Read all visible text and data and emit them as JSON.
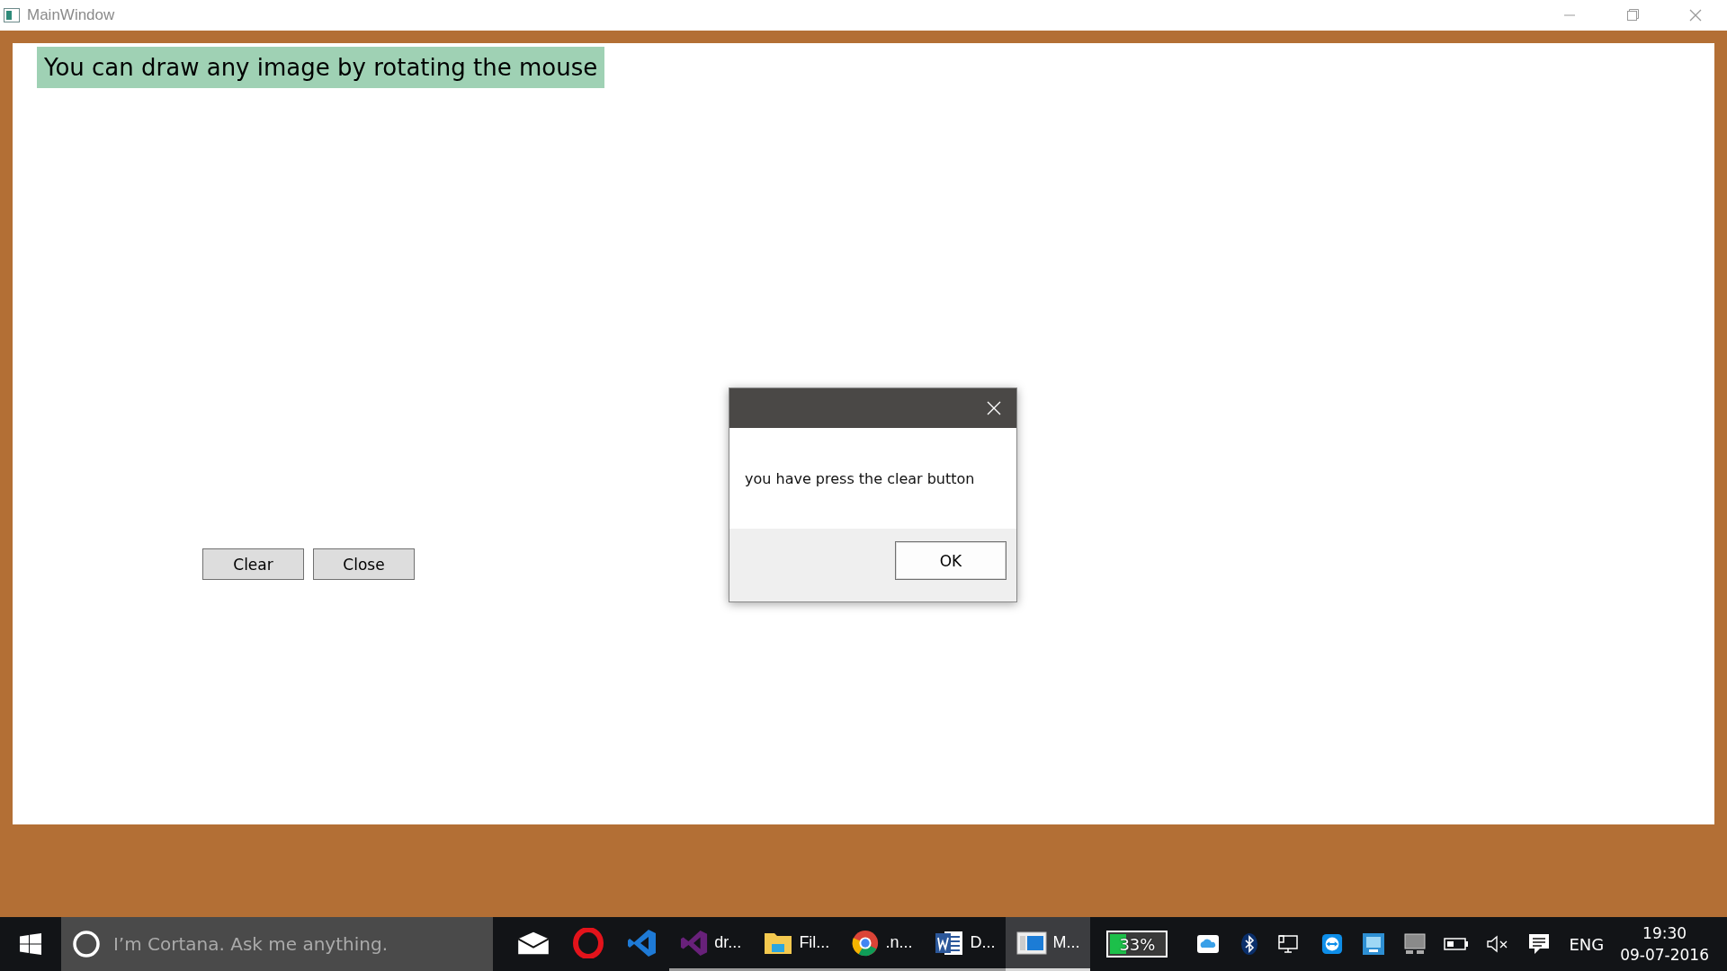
{
  "window": {
    "title": "MainWindow"
  },
  "heading": "You can draw any image by rotating the mouse",
  "buttons": [
    "Clear",
    "Close"
  ],
  "dialog": {
    "message": "you have press the clear button",
    "buttons": [
      "OK"
    ]
  },
  "taskbar": {
    "search": {
      "placeholder": "I’m Cortana. Ask me anything."
    },
    "apps": [
      {
        "running": false,
        "selected": false
      },
      {
        "running": false,
        "selected": false
      },
      {
        "running": false,
        "selected": false
      },
      {
        "label": "dr...",
        "running": true,
        "selected": false
      },
      {
        "label": "Fil...",
        "running": true,
        "selected": false
      },
      {
        "label": ".n...",
        "running": true,
        "selected": false
      },
      {
        "label": "D...",
        "running": true,
        "selected": false
      },
      {
        "label": "M...",
        "running": true,
        "selected": true
      }
    ],
    "battery": {
      "text": "33%",
      "level": 0.33
    },
    "language": "ENG",
    "time": "19:30",
    "date": "09-07-2016"
  }
}
